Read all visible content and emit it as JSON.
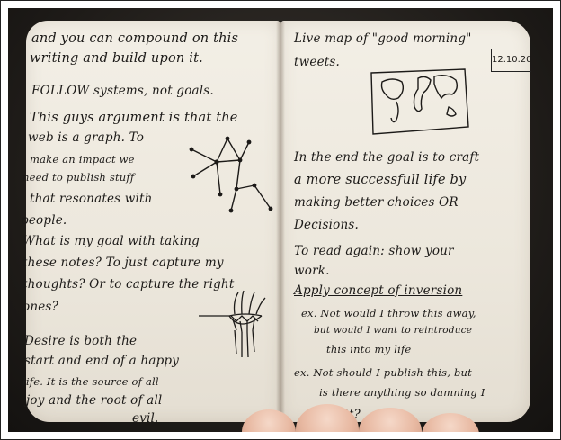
{
  "notebook": {
    "left_page": {
      "lines": [
        "and you can compound on this",
        "writing and build upon it.",
        "FOLLOW systems, not goals.",
        "This guys argument is that the",
        "web is a graph. To",
        "make an impact we",
        "need to publish stuff",
        "that resonates with",
        "people.",
        "What is my goal with taking",
        "these notes? To just capture my",
        "thoughts? Or to capture the right",
        "ones?",
        "Desire is both the",
        "start and end of a happy",
        "life. It is the source of all",
        "joy and the root of all",
        "evil."
      ]
    },
    "right_page": {
      "date": "12.10.20",
      "lines": [
        "Live map of \"good morning\"",
        "tweets.",
        "In the end the goal is to craft",
        "a more successfull life by",
        "making better choices OR",
        "Decisions.",
        "To read again: show your",
        "work.",
        "Apply concept of inversion",
        "ex. Not would I throw this away,",
        "but would I want to reintroduce",
        "this into my life",
        "ex. Not should I publish this, but",
        "is there anything so damning I",
        "can't?"
      ]
    },
    "colors": {
      "ink": "#1c1a18",
      "paper": "#efeae0",
      "background": "#1e1b18",
      "skin": "#e8b9a2"
    }
  }
}
